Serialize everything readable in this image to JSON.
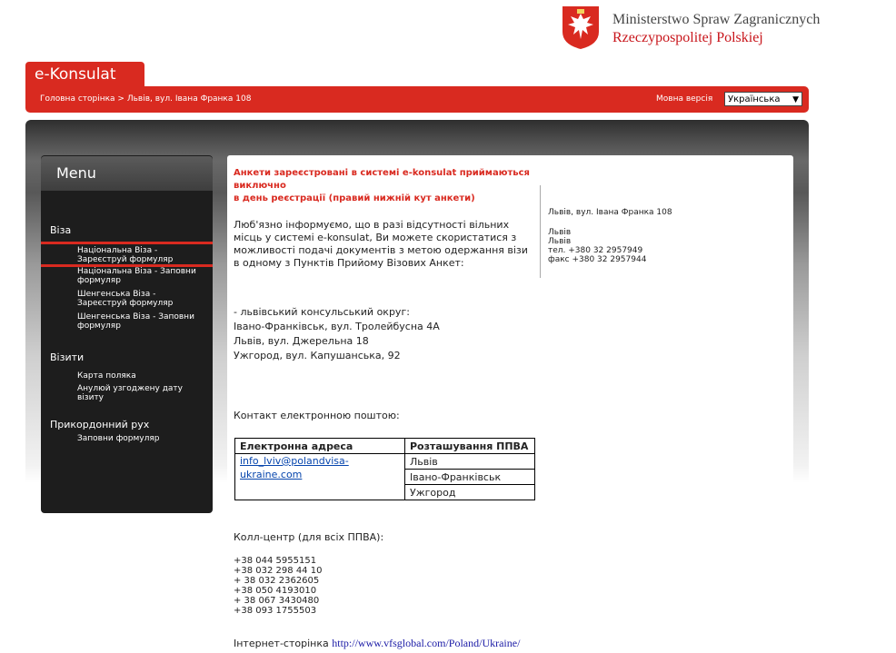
{
  "header": {
    "ministry_line1": "Ministerstwo Spraw Zagranicznych",
    "ministry_line2": "Rzeczypospolitej Polskiej"
  },
  "brand": {
    "tab_label": "e-Konsulat"
  },
  "nav": {
    "breadcrumb": "Головна сторінка > Львів, вул. Івана Франка 108",
    "lang_label": "Мовна версія",
    "lang_selected": "Українська"
  },
  "menu": {
    "title": "Menu",
    "sections": [
      {
        "label": "Віза",
        "items": [
          "Національна Віза - Зареєструй формуляр",
          "Національна Віза - Заповни формуляр",
          "Шенгенська Віза - Зареєструй формуляр",
          "Шенгенська Віза - Заповни формуляр"
        ]
      },
      {
        "label": "Візити",
        "items": [
          "Карта поляка",
          "Анулюй узгоджену дату візиту"
        ]
      },
      {
        "label": "Прикордонний рух",
        "items": [
          "Заповни формуляр"
        ]
      }
    ]
  },
  "content": {
    "notice_line1": "Анкети зареєстровані в системі e-konsulat приймаються виключно",
    "notice_line2": "в день реєстрації (правий нижній кут анкети)",
    "intro": "Люб'язно інформуємо, що в разі відсутності вільних місць у системі e-konsulat, Ви можете скористатися з можливості подачі документів з метою одержання візи в одному з Пунктів Прийому Візових Анкет:",
    "district": "- львівський консульський округ:",
    "locations": [
      "Івано-Франківськ, вул. Тролейбусна 4А",
      "Львів, вул. Джерельна 18",
      "Ужгород, вул. Капушанська, 92"
    ],
    "email_intro": "Контакт електронною поштою:",
    "table": {
      "col1": "Електронна адреса",
      "col2": "Розташування ППВА",
      "email": "info_lviv@polandvisa-ukraine.com",
      "places": [
        "Львів",
        "Івано-Франківськ",
        "Ужгород"
      ]
    },
    "callcenter": "Колл-центр (для всіх ППВА):",
    "phones": [
      "+38 044 5955151",
      "+38 032 298 44 10",
      "+ 38 032 2362605",
      "+38 050 4193010",
      "+ 38 067 3430480",
      "+38 093 1755503"
    ],
    "website_label": "Інтернет-сторінка",
    "website_url": "http://www.vfsglobal.com/Poland/Ukraine/"
  },
  "address": {
    "line1": "Львів, вул. Івана Франка 108",
    "city1": "Львів",
    "city2": "Львів",
    "tel": "тел. +380 32 2957949",
    "fax": "факс +380 32 2957944"
  }
}
